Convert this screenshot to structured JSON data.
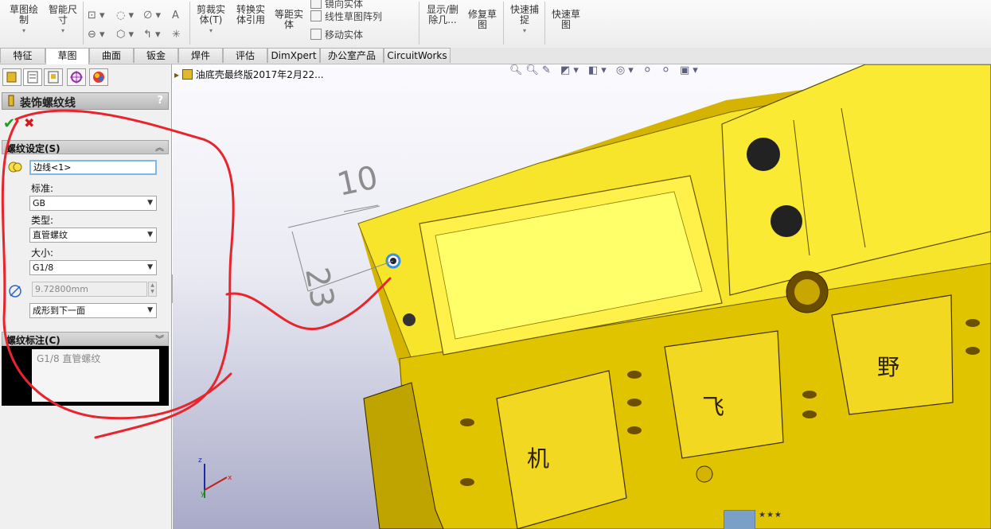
{
  "ribbon": {
    "sketch_label": "草图绘\n制",
    "smart_dim_label": "智能尺\n寸",
    "trim_label": "剪裁实\n体(T)",
    "convert_label": "转换实\n体引用",
    "offset_label": "等距实\n体",
    "mirror_label": "镜向实体",
    "linear_pattern_label": "线性草图阵列",
    "move_label": "移动实体",
    "show_delete_label": "显示/删\n除几...",
    "repair_label": "修复草\n图",
    "quick_snap_label": "快速捕\n捉",
    "quick_sketch_label": "快速草\n图"
  },
  "tabs": [
    "特征",
    "草图",
    "曲面",
    "钣金",
    "焊件",
    "评估",
    "DimXpert",
    "办公室产品",
    "CircuitWorks"
  ],
  "active_tab_index": 1,
  "panel": {
    "title": "装饰螺纹线",
    "help": "?",
    "section1_title": "螺纹设定(S)",
    "edge_value": "边线<1>",
    "standard_label": "标准:",
    "standard_value": "GB",
    "type_label": "类型:",
    "type_value": "直管螺纹",
    "size_label": "大小:",
    "size_value": "G1/8",
    "diameter_value": "9.72800mm",
    "end_condition": "成形到下一面",
    "section2_title": "螺纹标注(C)",
    "annotation_text": "G1/8 直管螺纹"
  },
  "viewport": {
    "tree_label": "油底壳最终版2017年2月22...",
    "dim_horizontal": "10",
    "dim_vertical": "23",
    "char_1": "机",
    "char_2": "飞",
    "char_3": "野",
    "triad": {
      "x": "x",
      "y": "y",
      "z": "z"
    },
    "rating": "★★★"
  },
  "colors": {
    "part_yellow": "#f5e21b",
    "part_shadow": "#8a7a00",
    "hole_dark": "#222222",
    "annotation_red": "#e8242c",
    "selection_blue": "#3b8fe0"
  }
}
